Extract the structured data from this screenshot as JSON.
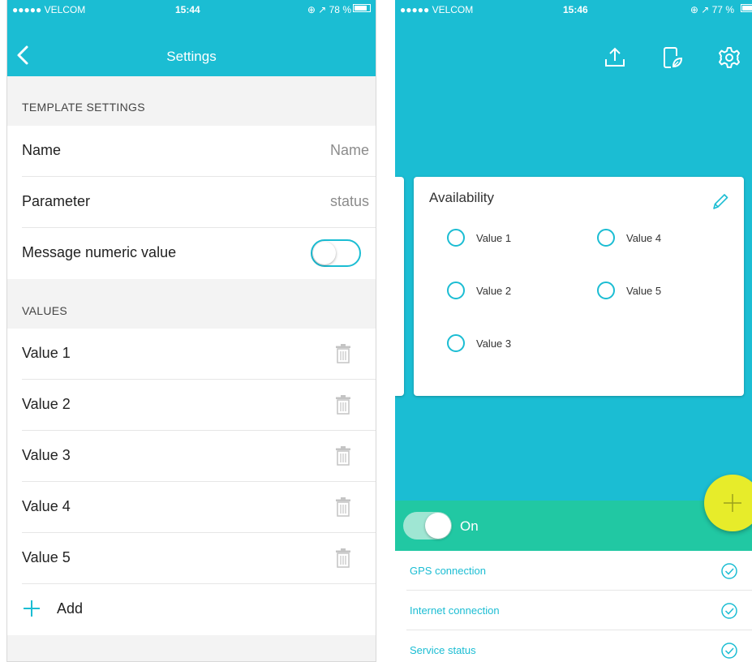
{
  "left_screen": {
    "status_bar": {
      "carrier": "●●●●● VELCOM",
      "time": "15:44",
      "battery": "⊕ ↗ 78 %"
    },
    "nav": {
      "title": "Settings"
    },
    "template_section": {
      "header": "TEMPLATE SETTINGS",
      "name": {
        "label": "Name",
        "value": "Name"
      },
      "parameter": {
        "label": "Parameter",
        "value": "status"
      },
      "numeric": {
        "label": "Message numeric value",
        "enabled": false
      }
    },
    "values_section": {
      "header": "VALUES",
      "items": [
        "Value 1",
        "Value 2",
        "Value 3",
        "Value 4",
        "Value 5"
      ],
      "add_label": "Add"
    }
  },
  "right_screen": {
    "status_bar": {
      "carrier": "●●●●● VELCOM",
      "time": "15:46",
      "battery": "⊕ ↗ 77 %"
    },
    "toolbar_icons": [
      "upload-icon",
      "phone-leaf-icon",
      "gear-icon"
    ],
    "card": {
      "title": "Availability",
      "options": [
        "Value 1",
        "Value 2",
        "Value 3",
        "Value 4",
        "Value 5"
      ]
    },
    "power": {
      "label": "On",
      "enabled": true
    },
    "status_items": [
      "GPS connection",
      "Internet connection",
      "Service status"
    ]
  },
  "colors": {
    "primary": "#1bbdd3",
    "green": "#21c8a3",
    "fab": "#e7ec2a",
    "gray_text": "#8c8c8c"
  }
}
